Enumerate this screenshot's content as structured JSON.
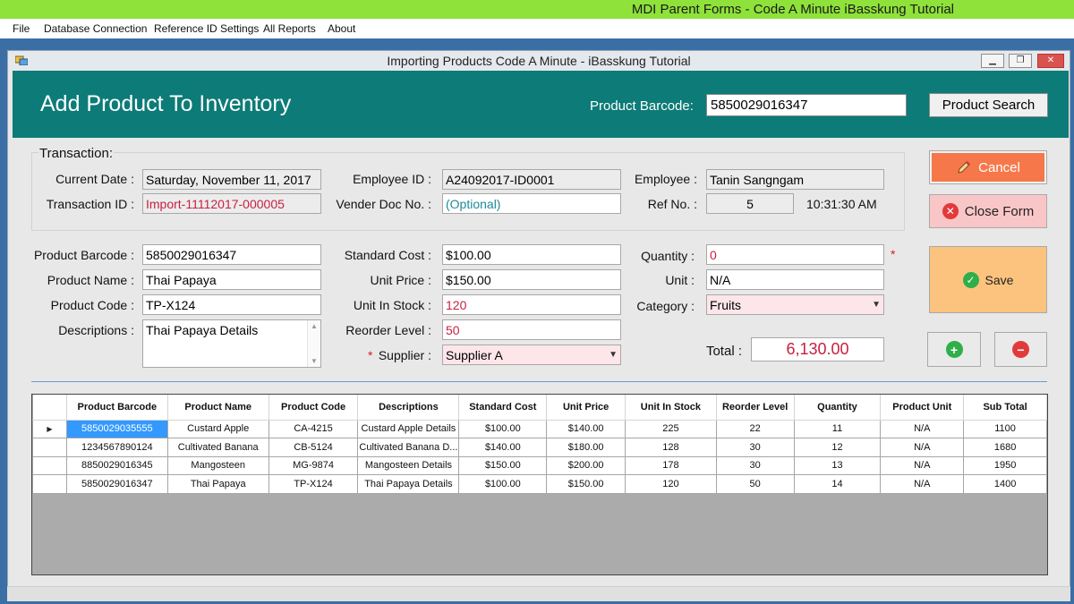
{
  "parent": {
    "title": "MDI Parent Forms - Code A Minute iBasskung Tutorial",
    "menu": [
      "File",
      "Database Connection",
      "Reference ID Settings",
      "All Reports",
      "About"
    ]
  },
  "child": {
    "title": "Importing Products Code A Minute - iBasskung Tutorial",
    "min": "▁",
    "max": "❐",
    "close": "✕"
  },
  "header": {
    "title": "Add Product To Inventory",
    "barcode_label": "Product Barcode:",
    "barcode_value": "5850029016347",
    "search_button": "Product Search"
  },
  "transaction": {
    "group_title": "Transaction:",
    "current_date_label": "Current Date :",
    "current_date": "Saturday, November 11, 2017",
    "transaction_id_label": "Transaction ID :",
    "transaction_id": "Import-11112017-000005",
    "employee_id_label": "Employee ID :",
    "employee_id": "A24092017-ID0001",
    "vender_doc_label": "Vender Doc No. :",
    "vender_doc": "(Optional)",
    "employee_label": "Employee :",
    "employee": "Tanin Sangngam",
    "ref_no_label": "Ref No. :",
    "ref_no": "5",
    "time": "10:31:30 AM"
  },
  "product": {
    "barcode_label": "Product Barcode :",
    "barcode": "5850029016347",
    "name_label": "Product Name :",
    "name": "Thai Papaya",
    "code_label": "Product Code :",
    "code": "TP-X124",
    "descriptions_label": "Descriptions :",
    "descriptions": "Thai Papaya Details",
    "standard_cost_label": "Standard Cost :",
    "standard_cost": "$100.00",
    "unit_price_label": "Unit Price :",
    "unit_price": "$150.00",
    "unit_in_stock_label": "Unit In Stock :",
    "unit_in_stock": "120",
    "reorder_level_label": "Reorder Level :",
    "reorder_level": "50",
    "supplier_star": "*",
    "supplier_label": "Supplier :",
    "supplier": "Supplier A",
    "quantity_label": "Quantity :",
    "quantity": "0",
    "quantity_star": "*",
    "unit_label": "Unit :",
    "unit": "N/A",
    "category_label": "Category :",
    "category": "Fruits",
    "total_label": "Total :",
    "total": "6,130.00"
  },
  "buttons": {
    "cancel": "Cancel",
    "close_form": "Close Form",
    "save": "Save"
  },
  "grid": {
    "columns": [
      "Product Barcode",
      "Product Name",
      "Product Code",
      "Descriptions",
      "Standard Cost",
      "Unit Price",
      "Unit In Stock",
      "Reorder Level",
      "Quantity",
      "Product Unit",
      "Sub Total"
    ],
    "current_row_marker": "▶",
    "rows": [
      [
        "5850029035555",
        "Custard Apple",
        "CA-4215",
        "Custard Apple Details",
        "$100.00",
        "$140.00",
        "225",
        "22",
        "11",
        "N/A",
        "1100"
      ],
      [
        "1234567890124",
        "Cultivated Banana",
        "CB-5124",
        "Cultivated Banana D...",
        "$140.00",
        "$180.00",
        "128",
        "30",
        "12",
        "N/A",
        "1680"
      ],
      [
        "8850029016345",
        "Mangosteen",
        "MG-9874",
        "Mangosteen Details",
        "$150.00",
        "$200.00",
        "178",
        "30",
        "13",
        "N/A",
        "1950"
      ],
      [
        "5850029016347",
        "Thai Papaya",
        "TP-X124",
        "Thai Papaya Details",
        "$100.00",
        "$150.00",
        "120",
        "50",
        "14",
        "N/A",
        "1400"
      ]
    ]
  },
  "colors": {
    "parent_title": "#8ee23a",
    "banner": "#0d7b77",
    "cancel": "#f6784a",
    "close_form": "#f9c6c8",
    "save": "#fcc37e",
    "selection": "#3399ff",
    "error_text": "#c82040"
  },
  "icons": {
    "cancel": "pencil-icon",
    "close_form": "close-circle-icon",
    "save": "check-circle-icon",
    "add": "plus-circle-icon",
    "remove": "minus-circle-icon"
  }
}
